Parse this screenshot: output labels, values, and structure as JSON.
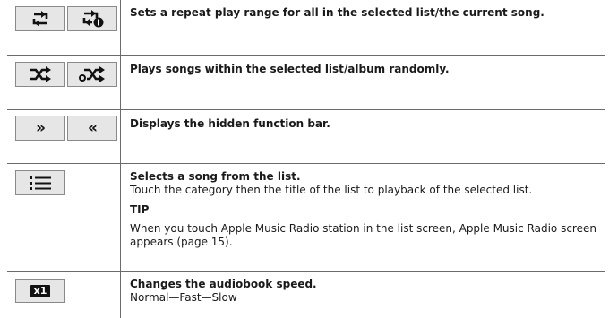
{
  "rows": [
    {
      "title": "Sets a repeat play range for all in the selected list/the current song.",
      "icons": [
        "repeat-all-icon",
        "repeat-one-icon"
      ]
    },
    {
      "title": "Plays songs within the selected list/album randomly.",
      "icons": [
        "shuffle-songs-icon",
        "shuffle-albums-icon"
      ]
    },
    {
      "title": "Displays the hidden function bar.",
      "icons": [
        "chevron-right-double-icon",
        "chevron-left-double-icon"
      ],
      "glyph_right": "»",
      "glyph_left": "«"
    },
    {
      "title": "Selects a song from the list.",
      "body": "Touch the category then the title of the list to playback of the selected list.",
      "tip_heading": "TIP",
      "tip_body": "When you touch Apple Music Radio station in the list screen, Apple Music Radio screen appears (page 15).",
      "icons": [
        "list-icon"
      ]
    },
    {
      "title": "Changes the audiobook speed.",
      "body": "Normal—Fast—Slow",
      "icons": [
        "speed-x1-icon"
      ],
      "speed_label": "x1"
    }
  ]
}
